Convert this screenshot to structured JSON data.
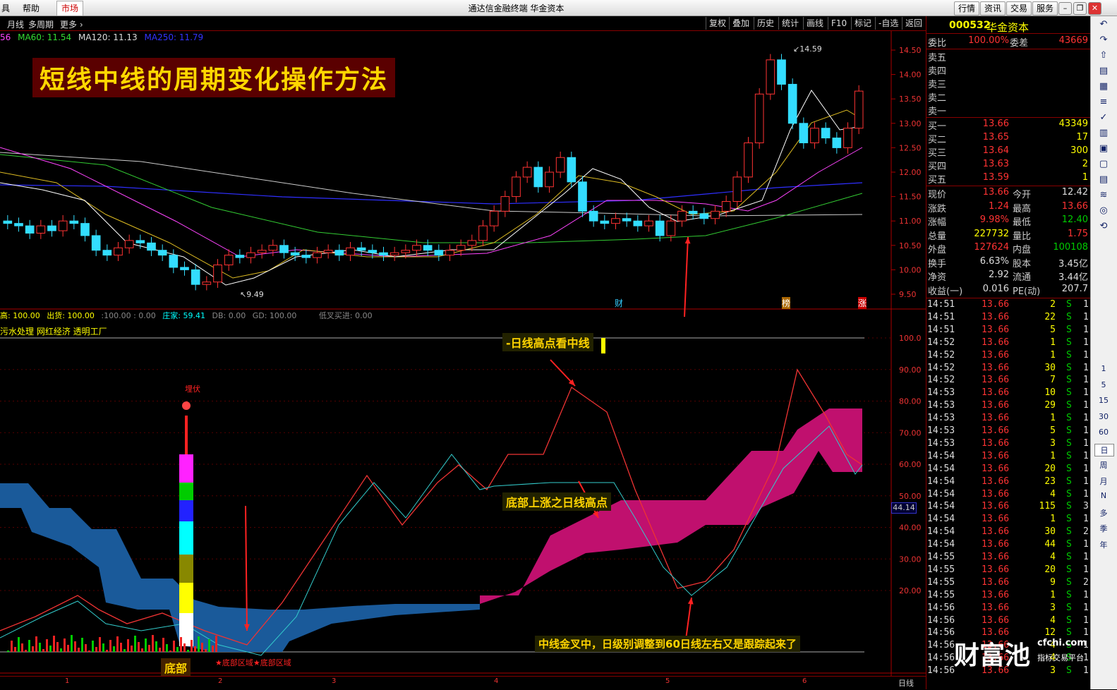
{
  "menubar": {
    "left_items": [
      "具",
      "帮助",
      "市场"
    ],
    "window_title": "通达信金融终端  华金资本",
    "right_buttons": [
      "行情",
      "资讯",
      "交易",
      "服务"
    ]
  },
  "toolbar": {
    "left_items": [
      "月线",
      "多周期",
      "更多"
    ],
    "right_items": [
      "复权",
      "叠加",
      "历史",
      "统计",
      "画线",
      "F10",
      "标记",
      "-自选",
      "返回"
    ]
  },
  "ma_legend": [
    {
      "label": "56",
      "color": "#ff44ff"
    },
    {
      "label": "MA60: 11.54",
      "color": "#33dd33"
    },
    {
      "label": "MA120: 11.13",
      "color": "#dddddd"
    },
    {
      "label": "MA250: 11.79",
      "color": "#3333ff"
    }
  ],
  "title_banner": "短线中线的周期变化操作方法",
  "price_axis": [
    "14.50",
    "14.00",
    "13.50",
    "13.00",
    "12.50",
    "12.00",
    "11.50",
    "11.00",
    "10.50",
    "10.00",
    "9.50"
  ],
  "price_markers": {
    "high": "14.59",
    "low": "9.49"
  },
  "event_marks": [
    "财",
    "榜",
    "涨"
  ],
  "indicator_legend": [
    "高: 100.00",
    "出货: 100.00",
    ":100.00 : 0.00",
    "庄家: 59.41",
    "DB: 0.00",
    "GD: 100.00",
    "低叉买进: 0.00"
  ],
  "indicator_sub_legend": "污水处理 网红经济 透明工厂",
  "indicator_axis": [
    "100.0",
    "90.00",
    "80.00",
    "70.00",
    "60.00",
    "50.00",
    "40.00",
    "30.00",
    "20.00"
  ],
  "indicator_current": "44.14",
  "annotations": {
    "top": "-日线高点看中线",
    "mid": "底部上涨之日线高点",
    "bottom": "中线金叉中，日级别调整到60日线左右又是跟踪起来了",
    "bottom_left": "底部",
    "bottom_zone": "★底部区域★底部区域",
    "ambush": "埋伏"
  },
  "date_axis": [
    "1",
    "2",
    "3",
    "4",
    "5",
    "6"
  ],
  "date_axis_right": "日线",
  "quote": {
    "code": "000532",
    "name": "华金资本",
    "wei_bi_label": "委比",
    "wei_bi": "100.00%",
    "wei_cha_label": "委差",
    "wei_cha": "43669",
    "sells": [
      {
        "label": "卖五",
        "price": "",
        "vol": ""
      },
      {
        "label": "卖四",
        "price": "",
        "vol": ""
      },
      {
        "label": "卖三",
        "price": "",
        "vol": ""
      },
      {
        "label": "卖二",
        "price": "",
        "vol": ""
      },
      {
        "label": "卖一",
        "price": "",
        "vol": ""
      }
    ],
    "buys": [
      {
        "label": "买一",
        "price": "13.66",
        "vol": "43349"
      },
      {
        "label": "买二",
        "price": "13.65",
        "vol": "17"
      },
      {
        "label": "买三",
        "price": "13.64",
        "vol": "300"
      },
      {
        "label": "买四",
        "price": "13.63",
        "vol": "2"
      },
      {
        "label": "买五",
        "price": "13.59",
        "vol": "1"
      }
    ],
    "stats": [
      {
        "l1": "现价",
        "v1": "13.66",
        "c1": "red",
        "l2": "今开",
        "v2": "12.42",
        "c2": "white"
      },
      {
        "l1": "涨跌",
        "v1": "1.24",
        "c1": "red",
        "l2": "最高",
        "v2": "13.66",
        "c2": "red"
      },
      {
        "l1": "涨幅",
        "v1": "9.98%",
        "c1": "red",
        "l2": "最低",
        "v2": "12.40",
        "c2": "green"
      },
      {
        "l1": "总量",
        "v1": "227732",
        "c1": "yellow",
        "l2": "量比",
        "v2": "1.75",
        "c2": "red"
      },
      {
        "l1": "外盘",
        "v1": "127624",
        "c1": "red",
        "l2": "内盘",
        "v2": "100108",
        "c2": "green"
      },
      {
        "l1": "换手",
        "v1": "6.63%",
        "c1": "white",
        "l2": "股本",
        "v2": "3.45亿",
        "c2": "white"
      },
      {
        "l1": "净资",
        "v1": "2.92",
        "c1": "white",
        "l2": "流通",
        "v2": "3.44亿",
        "c2": "white"
      },
      {
        "l1": "收益(一)",
        "v1": "0.016",
        "c1": "white",
        "l2": "PE(动)",
        "v2": "207.7",
        "c2": "white"
      }
    ],
    "ticks": [
      [
        "14:51",
        "13.66",
        "2",
        "S",
        "1"
      ],
      [
        "14:51",
        "13.66",
        "22",
        "S",
        "1"
      ],
      [
        "14:51",
        "13.66",
        "5",
        "S",
        "1"
      ],
      [
        "14:52",
        "13.66",
        "1",
        "S",
        "1"
      ],
      [
        "14:52",
        "13.66",
        "1",
        "S",
        "1"
      ],
      [
        "14:52",
        "13.66",
        "30",
        "S",
        "1"
      ],
      [
        "14:52",
        "13.66",
        "7",
        "S",
        "1"
      ],
      [
        "14:53",
        "13.66",
        "10",
        "S",
        "1"
      ],
      [
        "14:53",
        "13.66",
        "29",
        "S",
        "1"
      ],
      [
        "14:53",
        "13.66",
        "1",
        "S",
        "1"
      ],
      [
        "14:53",
        "13.66",
        "5",
        "S",
        "1"
      ],
      [
        "14:53",
        "13.66",
        "3",
        "S",
        "1"
      ],
      [
        "14:54",
        "13.66",
        "1",
        "S",
        "1"
      ],
      [
        "14:54",
        "13.66",
        "20",
        "S",
        "1"
      ],
      [
        "14:54",
        "13.66",
        "23",
        "S",
        "1"
      ],
      [
        "14:54",
        "13.66",
        "4",
        "S",
        "1"
      ],
      [
        "14:54",
        "13.66",
        "115",
        "S",
        "3"
      ],
      [
        "14:54",
        "13.66",
        "1",
        "S",
        "1"
      ],
      [
        "14:54",
        "13.66",
        "30",
        "S",
        "2"
      ],
      [
        "14:54",
        "13.66",
        "44",
        "S",
        "1"
      ],
      [
        "14:55",
        "13.66",
        "4",
        "S",
        "1"
      ],
      [
        "14:55",
        "13.66",
        "20",
        "S",
        "1"
      ],
      [
        "14:55",
        "13.66",
        "9",
        "S",
        "2"
      ],
      [
        "14:55",
        "13.66",
        "1",
        "S",
        "1"
      ],
      [
        "14:56",
        "13.66",
        "3",
        "S",
        "1"
      ],
      [
        "14:56",
        "13.66",
        "4",
        "S",
        "1"
      ],
      [
        "14:56",
        "13.66",
        "12",
        "S",
        "1"
      ],
      [
        "14:56",
        "13.66",
        "4",
        "S",
        "1"
      ],
      [
        "14:56",
        "13.66",
        "4",
        "S",
        "1"
      ],
      [
        "14:56",
        "13.66",
        "3",
        "S",
        "1"
      ]
    ]
  },
  "sidebar": [
    "1",
    "5",
    "15",
    "30",
    "60",
    "日",
    "周",
    "月",
    "N",
    "多",
    "季",
    "年"
  ],
  "watermark": {
    "brand": "财富池",
    "url": "cfchi.com",
    "slogan": "指标交易平台"
  }
}
